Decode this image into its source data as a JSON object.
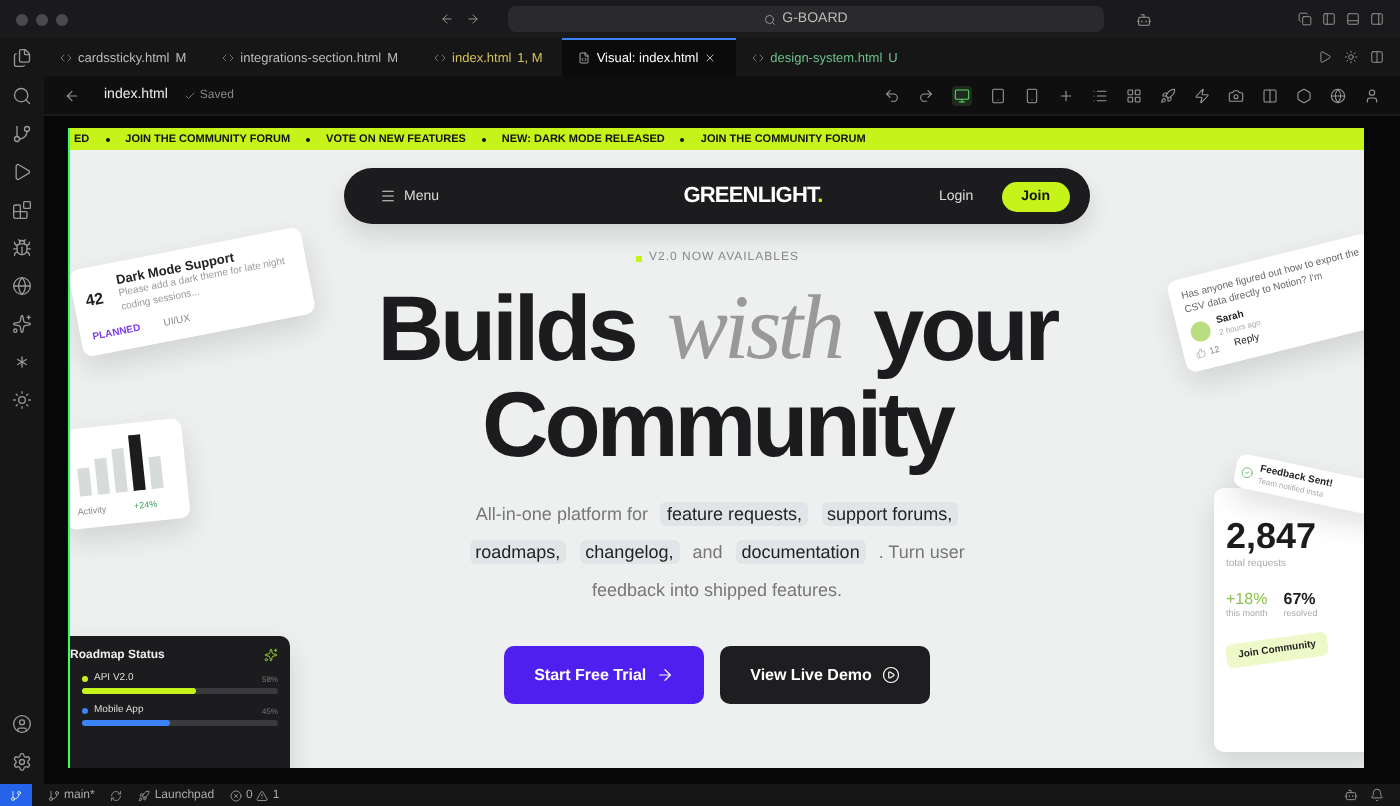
{
  "titlebar": {
    "search": "G-BOARD"
  },
  "tabs": [
    {
      "label": "cardssticky.html",
      "badge": "M",
      "selected": false,
      "kind": "modified"
    },
    {
      "label": "integrations-section.html",
      "badge": "M",
      "selected": false,
      "kind": "modified"
    },
    {
      "label": "index.html",
      "badge": "1, M",
      "selected": false,
      "kind": "warning"
    },
    {
      "label": "Visual: index.html",
      "selected": true,
      "kind": "visual"
    },
    {
      "label": "design-system.html",
      "badge": "U",
      "selected": false,
      "kind": "untracked"
    }
  ],
  "toolbar": {
    "file": "index.html",
    "status": "Saved"
  },
  "preview": {
    "ticker": [
      "ED",
      "JOIN THE COMMUNITY FORUM",
      "VOTE ON NEW FEATURES",
      "NEW: DARK MODE RELEASED",
      "JOIN THE COMMUNITY FORUM"
    ],
    "nav": {
      "menu": "Menu",
      "logo": "GREENLIGHT",
      "logo_dot": ".",
      "login": "Login",
      "join": "Join"
    },
    "version": "V2.0 NOW AVAILABLES",
    "headline": [
      {
        "text": "Builds",
        "kind": "plain"
      },
      {
        "text": "wisth",
        "kind": "accent"
      },
      {
        "text": "your",
        "kind": "plain"
      },
      {
        "text": "Community",
        "kind": "plain"
      }
    ],
    "description": [
      {
        "text": "All-in-one platform for",
        "kind": "text"
      },
      {
        "text": "feature requests,",
        "kind": "chip"
      },
      {
        "text": "support forums,",
        "kind": "chip"
      },
      {
        "text": "roadmaps,",
        "kind": "chip"
      },
      {
        "text": "changelog,",
        "kind": "chip"
      },
      {
        "text": "and",
        "kind": "text"
      },
      {
        "text": "documentation",
        "kind": "chip"
      },
      {
        "text": ". Turn user",
        "kind": "text"
      },
      {
        "text": "feedback into shipped features.",
        "kind": "text"
      }
    ],
    "buttons": [
      {
        "label": "Start Free Trial",
        "kind": "primary"
      },
      {
        "label": "View Live Demo",
        "kind": "secondary"
      }
    ],
    "feature_card": {
      "count": "42",
      "title": "Dark Mode Support",
      "body": "Please add a dark theme for late night coding sessions...",
      "status": "PLANNED",
      "tag": "UI/UX"
    },
    "activity_card": {
      "label": "Activity",
      "change": "+24%"
    },
    "roadmap_card": {
      "title": "Roadmap Status",
      "items": [
        {
          "name": "API V2.0",
          "reading": "58%",
          "level": 0.58,
          "color": "#c6f31a"
        },
        {
          "name": "Mobile App",
          "reading": "45%",
          "level": 0.45,
          "color": "#3b82f6"
        }
      ]
    },
    "comment_card": {
      "text": "Has anyone figured out how to export the CSV data directly to Notion? I'm",
      "author": "Sarah",
      "time": "2 hours ago",
      "likes": "12",
      "reply": "Reply"
    },
    "stats_card": {
      "toast_title": "Feedback Sent!",
      "toast_body": "Team notified insta",
      "total": "2,847",
      "total_label": "total requests",
      "growth": "+18%",
      "growth_label": "this month",
      "resolved": "67%",
      "resolved_label": "resolved",
      "cta": "Join Community"
    }
  },
  "statusbar": {
    "branch": "main*",
    "launchpad": "Launchpad",
    "errors": "0",
    "warnings": "1"
  }
}
